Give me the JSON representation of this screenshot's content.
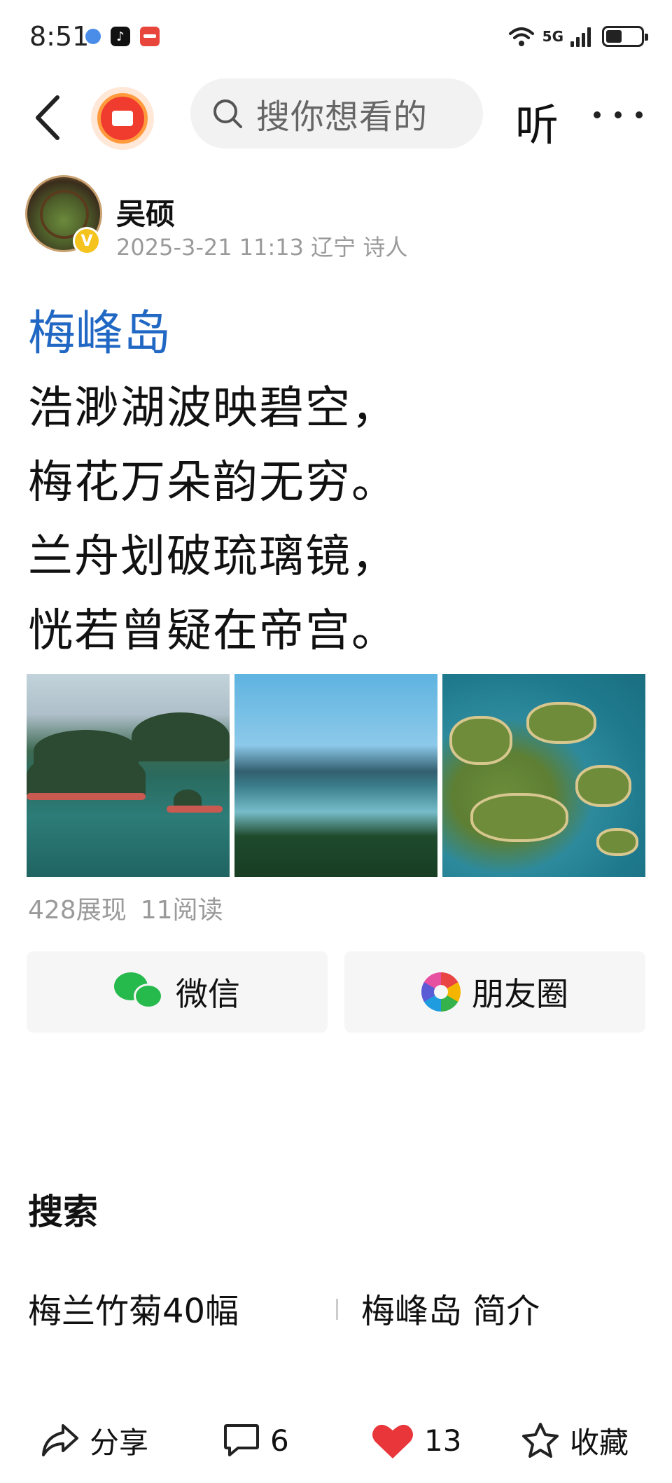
{
  "status_bar": {
    "time": "8:51",
    "network": "5G"
  },
  "nav": {
    "search_placeholder": "搜你想看的",
    "listen_label": "听"
  },
  "author": {
    "name": "吴硕",
    "meta": "2025-3-21 11:13 辽宁 诗人",
    "verified_badge": "V"
  },
  "post": {
    "title": "梅峰岛",
    "poem_lines": [
      "浩渺湖波映碧空，",
      "梅花万朵韵无穷。",
      "兰舟划破琉璃镜，",
      "恍若曾疑在帝宫。"
    ],
    "stats": {
      "impressions": "428展现",
      "reads": "11阅读"
    }
  },
  "share": {
    "wechat_label": "微信",
    "moments_label": "朋友圈"
  },
  "search_section": {
    "title": "搜索",
    "suggestions": [
      "梅兰竹菊40幅",
      "梅峰岛 简介"
    ]
  },
  "toolbar": {
    "share_label": "分享",
    "comment_count": "6",
    "like_count": "13",
    "favorite_label": "收藏"
  },
  "colors": {
    "title_blue": "#2168c4",
    "like_red": "#e8363a",
    "wechat_green": "#26b94b",
    "meta_gray": "#9a9a9a"
  }
}
